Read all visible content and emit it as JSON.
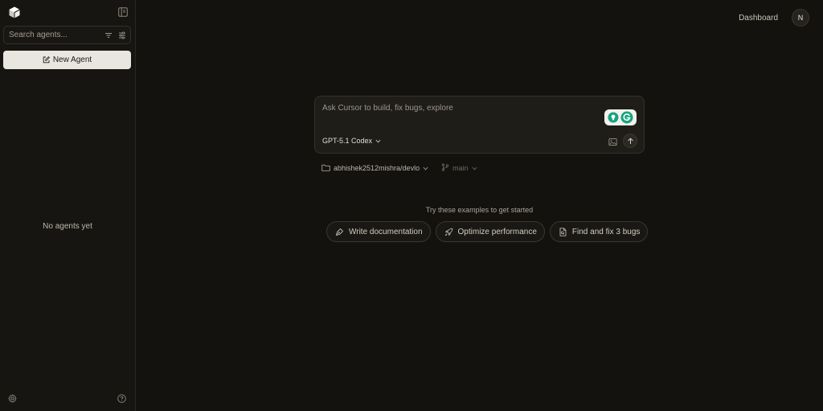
{
  "sidebar": {
    "search": {
      "placeholder": "Search agents..."
    },
    "new_agent_label": "New Agent",
    "empty_text": "No agents yet"
  },
  "header": {
    "dashboard_label": "Dashboard",
    "avatar_initial": "N"
  },
  "composer": {
    "placeholder": "Ask Cursor to build, fix bugs, explore",
    "model_label": "GPT-5.1 Codex"
  },
  "context": {
    "repo_label": "abhishek2512mishra/devlo",
    "branch_label": "main"
  },
  "examples": {
    "title": "Try these examples to get started",
    "items": [
      {
        "label": "Write documentation",
        "icon": "pen-nib-icon"
      },
      {
        "label": "Optimize performance",
        "icon": "rocket-icon"
      },
      {
        "label": "Find and fix 3 bugs",
        "icon": "file-search-icon"
      }
    ]
  },
  "colors": {
    "background": "#14120f",
    "sidebar": "#171511",
    "button_light": "#e9e6e0",
    "grammarly_green": "#15a37f"
  }
}
